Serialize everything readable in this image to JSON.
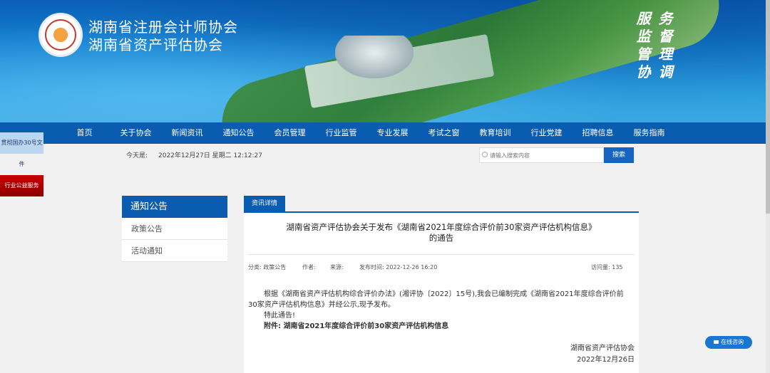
{
  "header": {
    "org_name_1": "湖南省注册会计师协会",
    "org_name_2": "湖南省资产评估协会",
    "slogan": [
      "服",
      "务",
      "监",
      "督",
      "管",
      "理",
      "协",
      "调"
    ]
  },
  "nav": {
    "items": [
      "首页",
      "关于协会",
      "新闻资讯",
      "通知公告",
      "会员管理",
      "行业监管",
      "专业发展",
      "考试之窗",
      "教育培训",
      "行业党建",
      "招聘信息",
      "服务指南"
    ]
  },
  "side_floats": {
    "item1": "贯彻国办30号文件",
    "item2": "行业公益服务"
  },
  "info_bar": {
    "today_label": "今天是:",
    "today_value": "2022年12月27日 星期二 12:12:27",
    "search_placeholder": "请输入搜索内容",
    "search_button": "搜索"
  },
  "sidebar": {
    "title": "通知公告",
    "items": [
      "政策公告",
      "活动通知"
    ]
  },
  "content": {
    "tab": "资讯详情",
    "title_line1": "湖南省资产评估协会关于发布《湖南省2021年度综合评价前30家资产评估机构信息》",
    "title_line2": "的通告",
    "meta": {
      "category": "分类: 政策公告",
      "author": "作者:",
      "source": "来源:",
      "published": "发布时间: 2022-12-26 16:20",
      "views": "访问量: 135"
    },
    "paragraph": "根据《湖南省资产评估机构综合评价办法》(湘评协〔2022〕15号),我会已编制完成《湖南省2021年度综合评价前30家资产评估机构信息》并经公示,现予发布。",
    "notice": "特此通告!",
    "attachment": "附件: 湖南省2021年度综合评价前30家资产评估机构信息",
    "signature_org": "湖南省资产评估协会",
    "signature_date": "2022年12月26日"
  },
  "chat": {
    "label": "在线咨询"
  },
  "colors": {
    "primary": "#0a5cb0",
    "background": "#f1f1f1"
  }
}
